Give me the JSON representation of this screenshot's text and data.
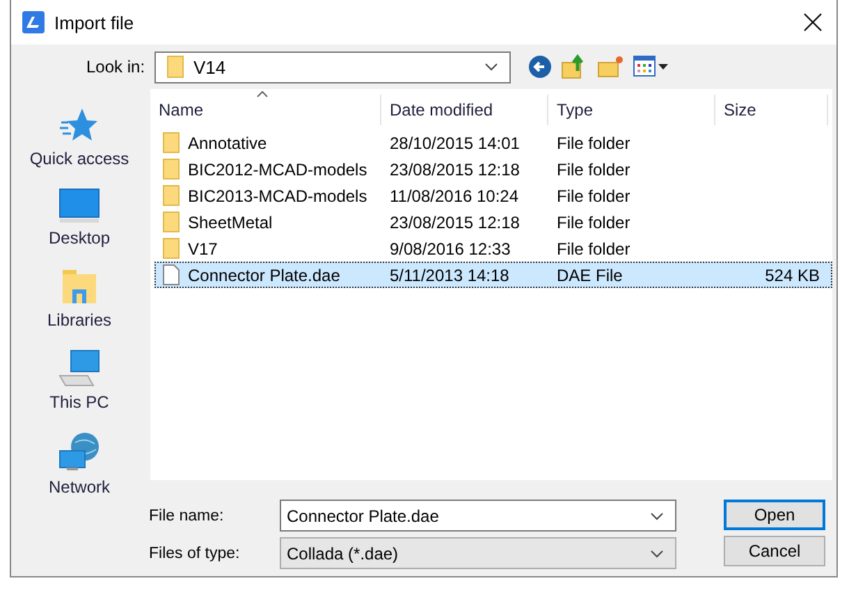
{
  "window": {
    "title": "Import file"
  },
  "look_in": {
    "label": "Look in:",
    "value": "V14"
  },
  "sidebar": {
    "items": [
      {
        "label": "Quick access",
        "kind": "star"
      },
      {
        "label": "Desktop",
        "kind": "desktop"
      },
      {
        "label": "Libraries",
        "kind": "libraries"
      },
      {
        "label": "This PC",
        "kind": "pc"
      },
      {
        "label": "Network",
        "kind": "network"
      }
    ]
  },
  "table": {
    "columns": [
      {
        "label": "Name",
        "sorted": true
      },
      {
        "label": "Date modified",
        "sorted": false
      },
      {
        "label": "Type",
        "sorted": false
      },
      {
        "label": "Size",
        "sorted": false
      }
    ],
    "rows": [
      {
        "name": "Annotative",
        "date": "28/10/2015 14:01",
        "type": "File folder",
        "kind": "folder",
        "selected": false
      },
      {
        "name": "BIC2012-MCAD-models",
        "date": "23/08/2015 12:18",
        "type": "File folder",
        "kind": "folder",
        "selected": false
      },
      {
        "name": "BIC2013-MCAD-models",
        "date": "11/08/2016 10:24",
        "type": "File folder",
        "kind": "folder",
        "selected": false
      },
      {
        "name": "SheetMetal",
        "date": "23/08/2015 12:18",
        "type": "File folder",
        "kind": "folder",
        "selected": false
      },
      {
        "name": "V17",
        "date": "9/08/2016 12:33",
        "type": "File folder",
        "kind": "folder",
        "selected": false
      },
      {
        "name": "Connector Plate.dae",
        "date": "5/11/2013 14:18",
        "type": "DAE File",
        "size": "524 KB",
        "kind": "file",
        "selected": true
      }
    ]
  },
  "file_name": {
    "label": "File name:",
    "value": "Connector Plate.dae"
  },
  "file_type": {
    "label": "Files of type:",
    "value": "Collada (*.dae)"
  },
  "buttons": [
    {
      "label": "Open",
      "default": true
    },
    {
      "label": "Cancel",
      "default": false
    }
  ]
}
